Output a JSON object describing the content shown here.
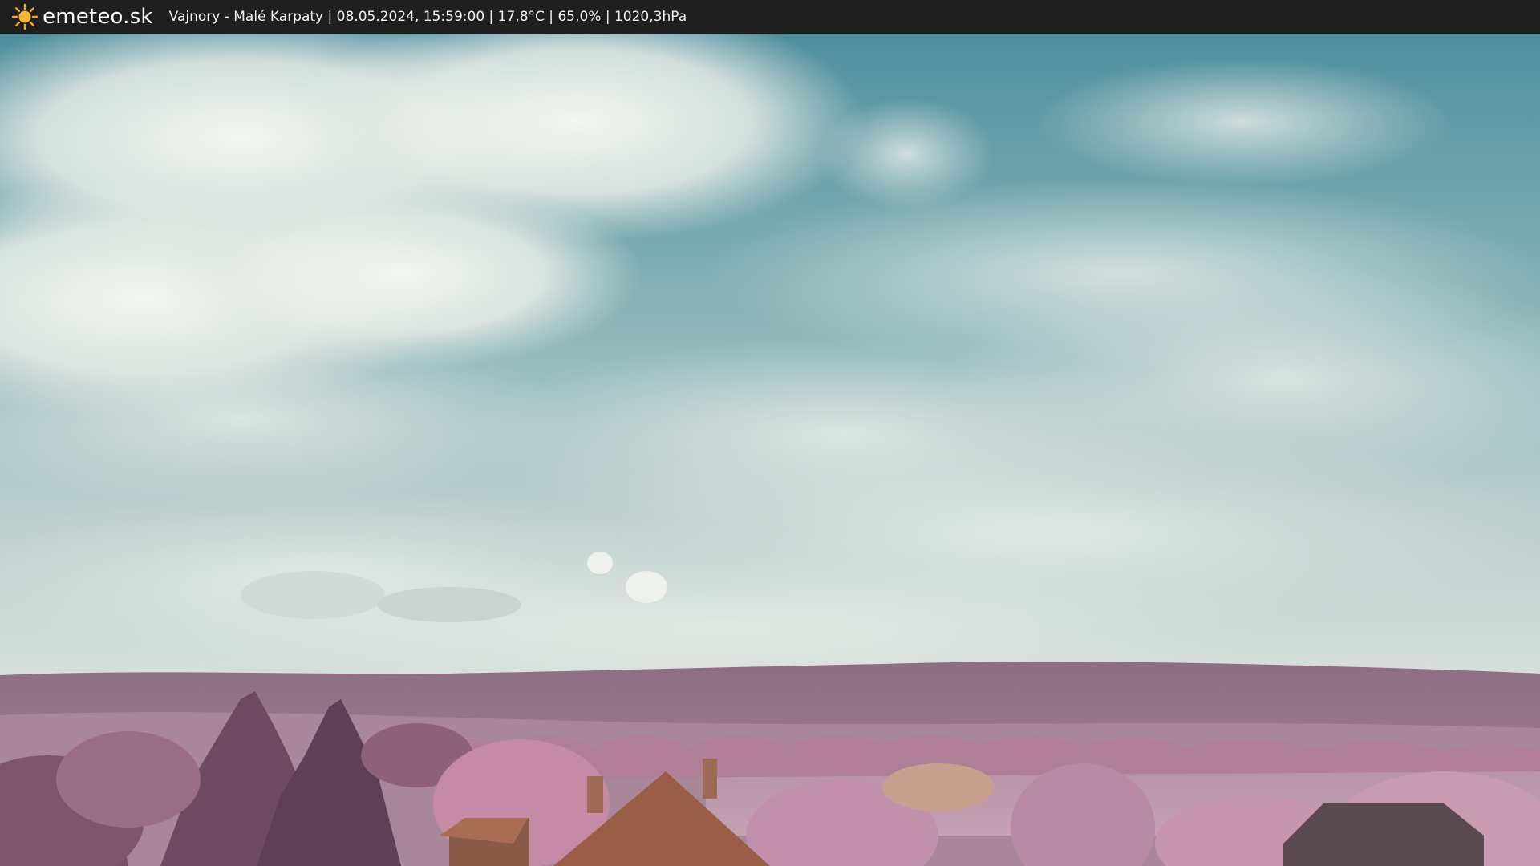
{
  "header": {
    "logo_text": "emeteo.sk",
    "logo_icon": "sun-icon",
    "caption": "Vajnory - Malé Karpaty | 08.05.2024, 15:59:00 | 17,8°C | 65,0% | 1020,3hPa"
  },
  "colors": {
    "bar": "#1f1f1f",
    "sun": "#f5a623",
    "sky_blue": "#5b9aa6",
    "cloud": "#e6ece6",
    "hills": "#9c7a8e",
    "trees": "#b9809c"
  }
}
